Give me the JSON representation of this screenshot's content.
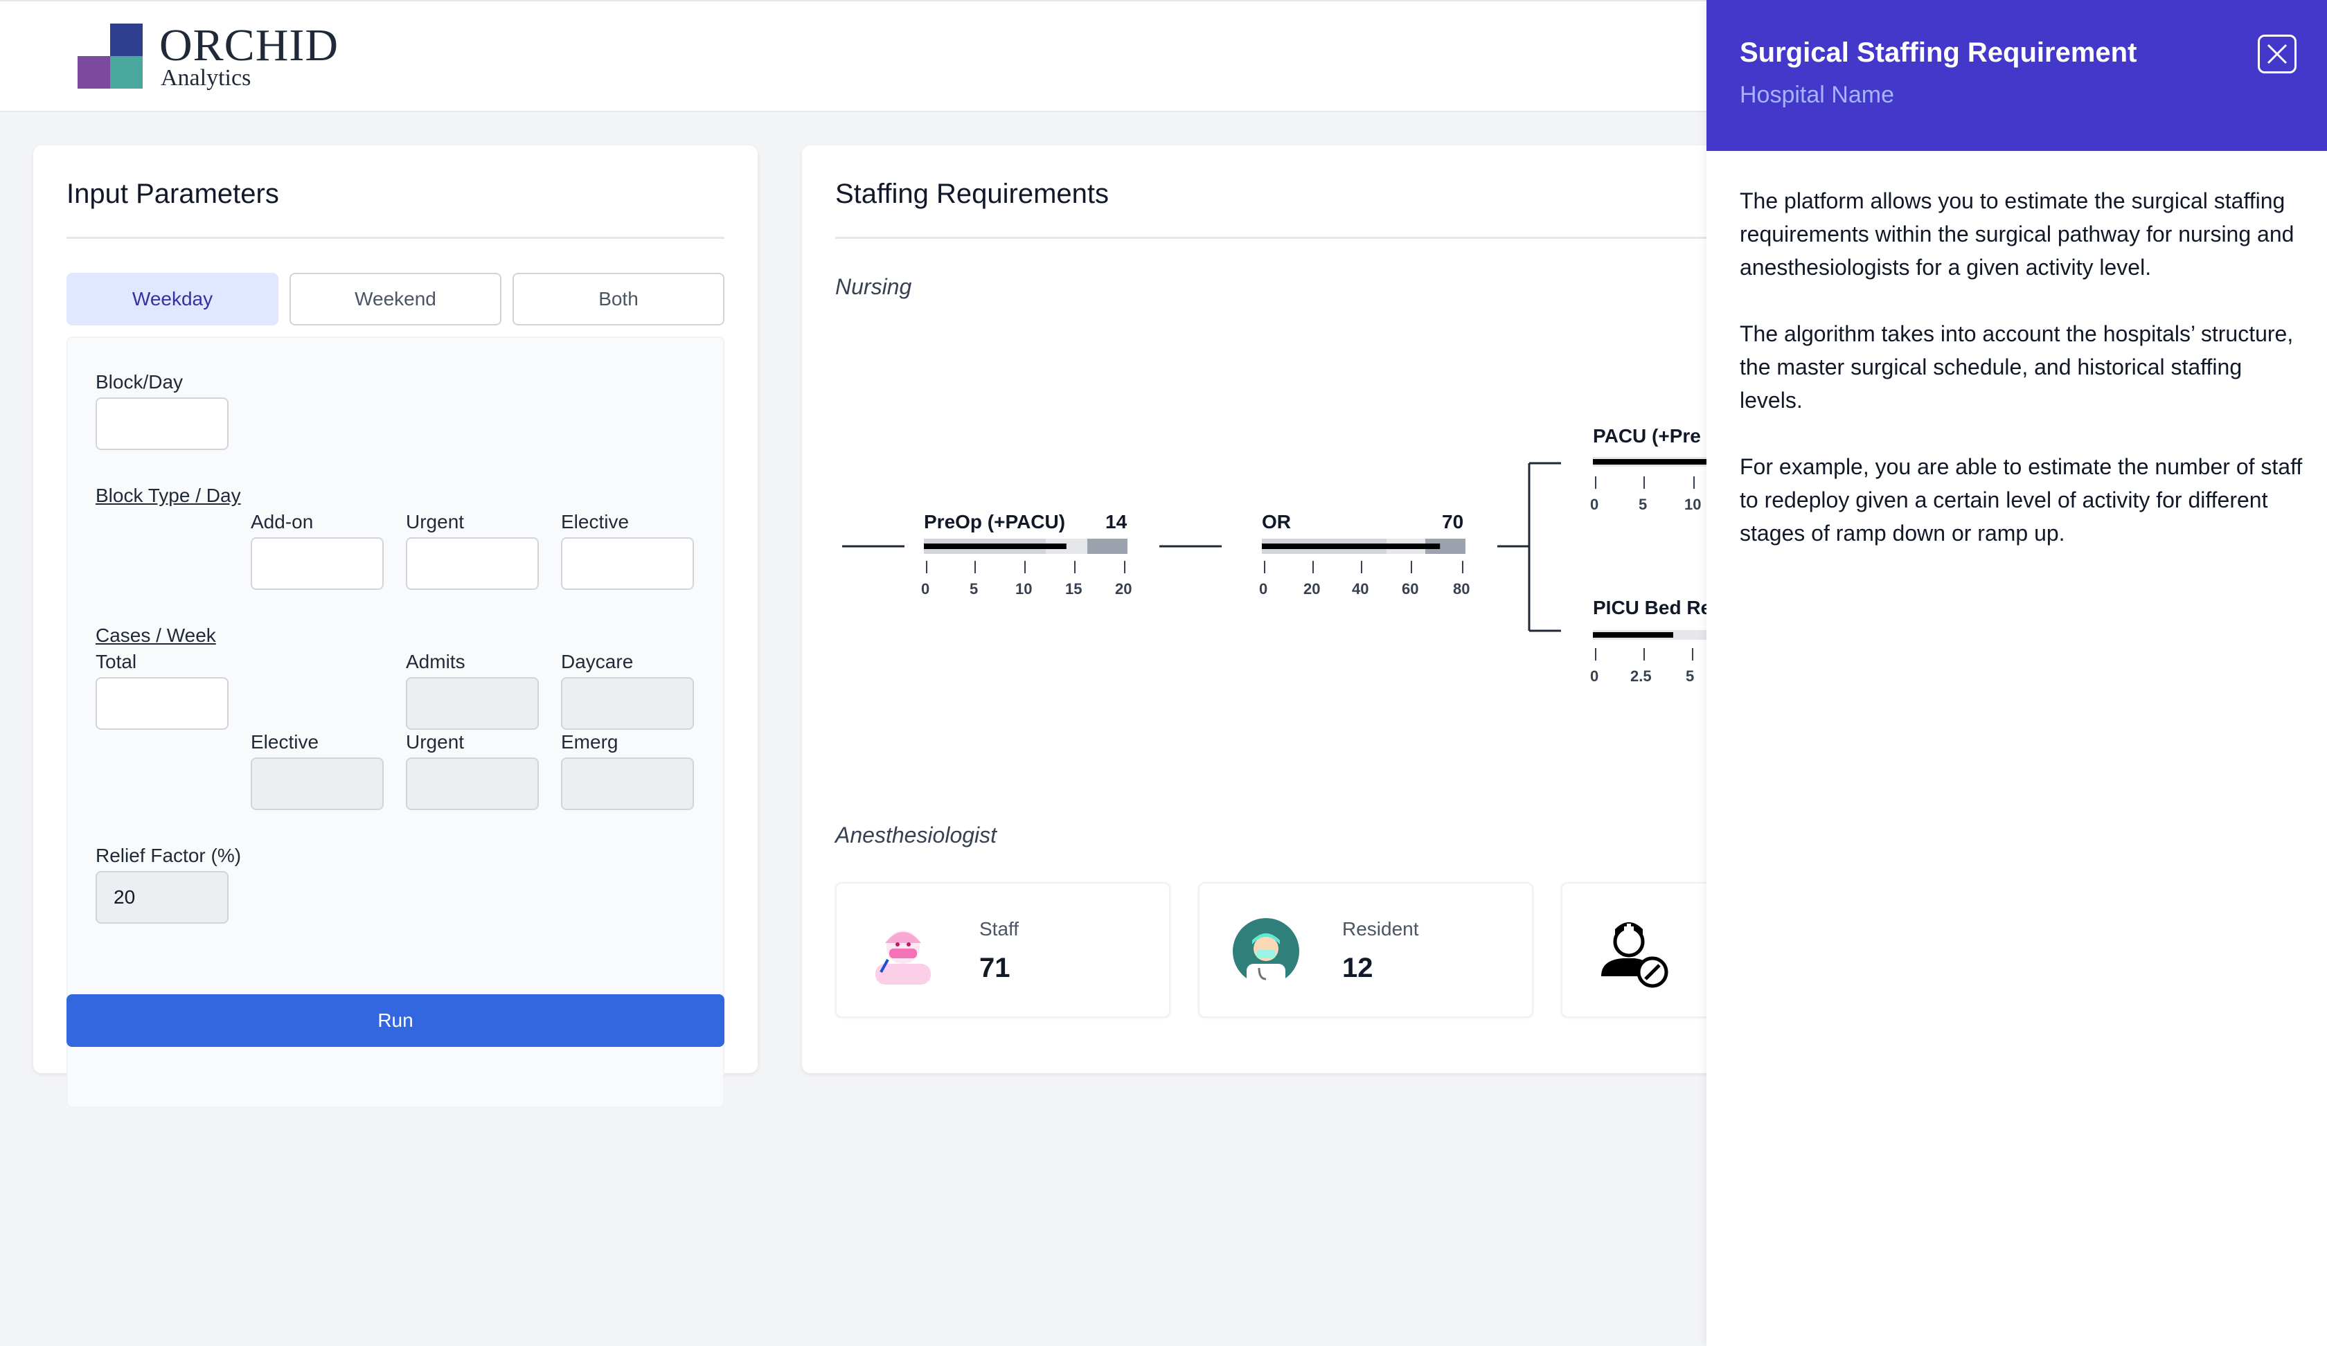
{
  "brand": {
    "name": "ORCHID",
    "sub": "Analytics",
    "colors": [
      "#2e3f8f",
      "#7c4a9e",
      "#4aa79d"
    ]
  },
  "input_panel": {
    "title": "Input Parameters",
    "tabs": [
      {
        "label": "Weekday",
        "active": true
      },
      {
        "label": "Weekend",
        "active": false
      },
      {
        "label": "Both",
        "active": false
      }
    ],
    "block_day_label": "Block/Day",
    "block_day_value": "",
    "block_type_label": "Block Type / Day",
    "addon_label": "Add-on",
    "urgent_label": "Urgent",
    "elective_label": "Elective",
    "cases_week_label": "Cases / Week",
    "total_label": "Total",
    "admits_label": "Admits",
    "daycare_label": "Daycare",
    "elective2_label": "Elective",
    "urgent2_label": "Urgent",
    "emerg_label": "Emerg",
    "relief_label": "Relief Factor (%)",
    "relief_value": "20",
    "run_label": "Run"
  },
  "staffing": {
    "title": "Staffing Requirements",
    "nursing_label": "Nursing",
    "gauges": {
      "preop": {
        "title": "PreOp (+PACU)",
        "value": "14",
        "ticks": [
          "0",
          "5",
          "10",
          "15",
          "20"
        ],
        "max": 20,
        "fill": 14
      },
      "or": {
        "title": "OR",
        "value": "70",
        "ticks": [
          "0",
          "20",
          "40",
          "60",
          "80"
        ],
        "max": 80,
        "fill": 70
      },
      "pacu": {
        "title": "PACU (+Pre",
        "ticks": [
          "0",
          "5",
          "10"
        ]
      },
      "picu": {
        "title": "PICU Bed Re",
        "ticks": [
          "0",
          "2.5",
          "5"
        ]
      }
    },
    "anesthesiologist_label": "Anesthesiologist",
    "stats": [
      {
        "label": "Staff",
        "value": "71"
      },
      {
        "label": "Resident",
        "value": "12"
      }
    ]
  },
  "drawer": {
    "title": "Surgical Staffing Requirement",
    "subtitle": "Hospital Name",
    "p1": "The platform allows you to estimate the surgical staffing requirements within the surgical pathway for nursing and anesthesiologists for a given activity level.",
    "p2": "The algorithm takes into account the hospitals’ structure, the master surgical schedule, and historical staffing levels.",
    "p3": "For example, you are able to estimate the number of staff to redeploy given a certain level of activity for different stages of ramp down or ramp up."
  }
}
